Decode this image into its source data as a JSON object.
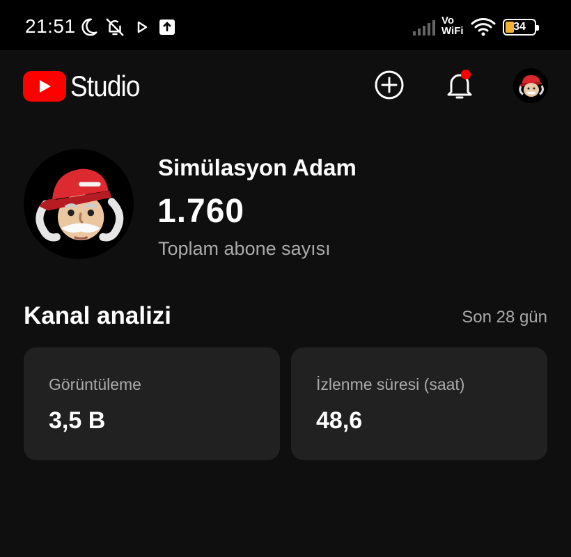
{
  "status_bar": {
    "time": "21:51",
    "network_label_top": "Vo",
    "network_label_bottom": "WiFi",
    "battery_level": "34",
    "icons": [
      "moon-icon",
      "bell-off-icon",
      "play-icon",
      "upload-icon",
      "signal-icon",
      "wifi-icon",
      "battery-icon"
    ]
  },
  "header": {
    "logo_text": "Studio",
    "icons": [
      "youtube-logo-icon",
      "create-icon",
      "notifications-icon",
      "avatar"
    ],
    "notification_dot_color": "#ff0000",
    "brand_color": "#ff0000"
  },
  "channel": {
    "name": "Simülasyon Adam",
    "subscriber_count": "1.760",
    "subscriber_label": "Toplam abone sayısı"
  },
  "analytics": {
    "title": "Kanal analizi",
    "period": "Son 28 gün",
    "cards": [
      {
        "label": "Görüntüleme",
        "value": "3,5 B"
      },
      {
        "label": "İzlenme süresi (saat)",
        "value": "48,6"
      }
    ]
  }
}
